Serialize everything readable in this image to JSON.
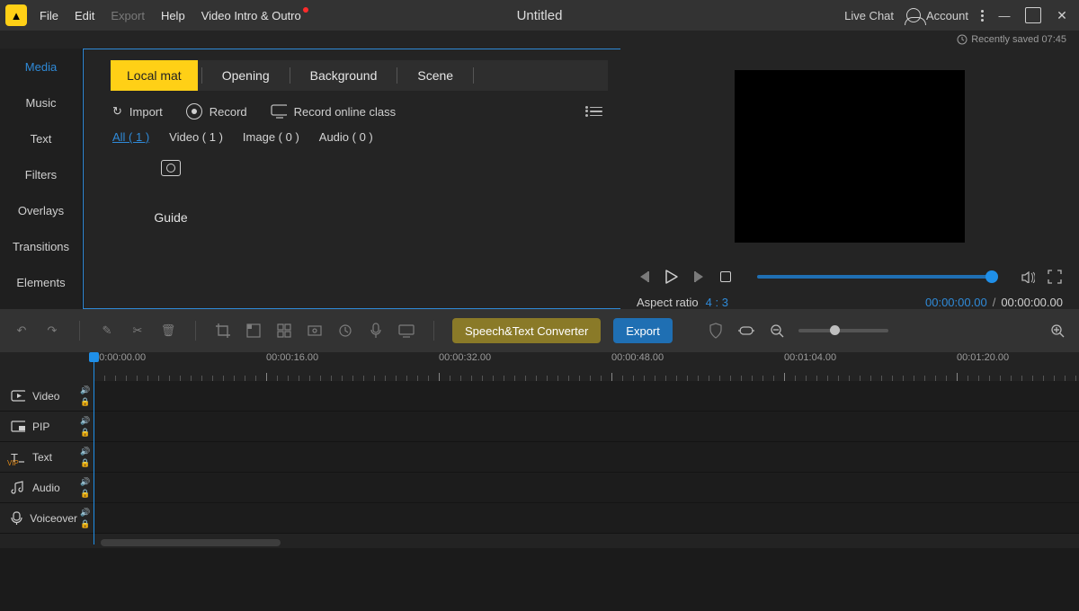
{
  "titlebar": {
    "menus": [
      "File",
      "Edit",
      "Export",
      "Help",
      "Video Intro & Outro"
    ],
    "menus_disabled_index": 2,
    "menus_dot_index": 4,
    "title": "Untitled",
    "live_chat": "Live Chat",
    "account": "Account"
  },
  "savestrip": {
    "text": "Recently saved 07:45"
  },
  "sidebar": {
    "tabs": [
      "Media",
      "Music",
      "Text",
      "Filters",
      "Overlays",
      "Transitions",
      "Elements"
    ],
    "active_index": 0
  },
  "library": {
    "tabs": [
      "Local mat",
      "Opening",
      "Background",
      "Scene"
    ],
    "active_index": 0,
    "actions": {
      "import": "Import",
      "record": "Record",
      "record_online": "Record online class"
    },
    "filters": [
      "All ( 1 )",
      "Video ( 1 )",
      "Image ( 0 )",
      "Audio ( 0 )"
    ],
    "filters_active_index": 0,
    "thumb_label": "Guide"
  },
  "preview": {
    "aspect_label": "Aspect ratio",
    "aspect_value": "4 : 3",
    "time_current": "00:00:00.00",
    "time_total": "00:00:00.00"
  },
  "toolbar": {
    "speech": "Speech&Text Converter",
    "export": "Export"
  },
  "ruler": {
    "labels": [
      "00:00:00.00",
      "00:00:16.00",
      "00:00:32.00",
      "00:00:48.00",
      "00:01:04.00",
      "00:01:20.00"
    ]
  },
  "tracks": [
    {
      "name": "Video"
    },
    {
      "name": "PIP"
    },
    {
      "name": "Text",
      "vip": true
    },
    {
      "name": "Audio"
    },
    {
      "name": "Voiceover"
    }
  ]
}
